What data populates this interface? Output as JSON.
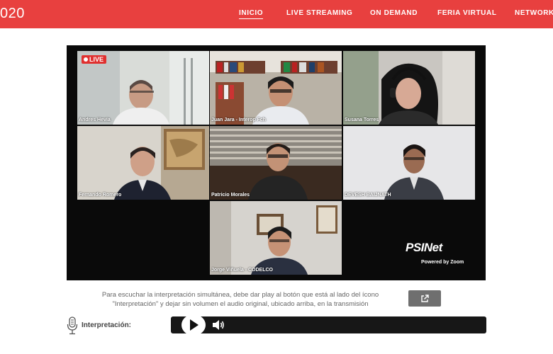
{
  "brand": {
    "text": "020"
  },
  "nav": {
    "items": [
      {
        "label": "INICIO",
        "active": true
      },
      {
        "label": "LIVE STREAMING",
        "active": false
      },
      {
        "label": "ON DEMAND",
        "active": false
      },
      {
        "label": "FERIA VIRTUAL",
        "active": false
      },
      {
        "label": "NETWORKING",
        "active": false
      }
    ]
  },
  "stream": {
    "live_label": "LIVE",
    "participants": [
      {
        "name": "Andres Hevia",
        "speaking": false
      },
      {
        "name": "Juan Jara - Interop Fch",
        "speaking": false
      },
      {
        "name": "Susana Torres",
        "speaking": false
      },
      {
        "name": "Fernando Romero",
        "speaking": true
      },
      {
        "name": "Patricio Morales",
        "speaking": false
      },
      {
        "name": "DEVESH BAIJNATH",
        "speaking": false
      },
      {
        "name": "Jorge Viñuela - CODELCO",
        "speaking": false
      }
    ],
    "logo_text": "PSINet",
    "powered_by": "Powered by Zoom"
  },
  "info": {
    "line1": "Para escuchar la interpretación simultánea, debe dar play al botón que está al lado del ícono",
    "line2": "\"Interpretación\" y dejar sin volumen el audio original, ubicado arriba, en la transmisión"
  },
  "interpretation": {
    "label": "Interpretación:"
  },
  "colors": {
    "brand_red": "#e8403f",
    "speaking_outline": "#3ddc3d",
    "button_gray": "#6f6f6f"
  },
  "icons": {
    "external": "external-link-icon",
    "mic": "microphone-icon",
    "play": "play-icon",
    "volume": "volume-icon"
  }
}
